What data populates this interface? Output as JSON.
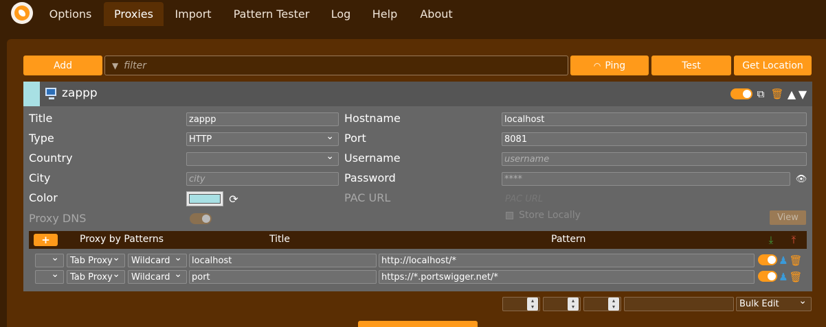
{
  "nav": {
    "tabs": [
      "Options",
      "Proxies",
      "Import",
      "Pattern Tester",
      "Log",
      "Help",
      "About"
    ],
    "active": "Proxies"
  },
  "toolbar": {
    "add": "Add",
    "filter_placeholder": "filter",
    "ping": "Ping",
    "test": "Test",
    "get_location": "Get Location"
  },
  "proxy": {
    "name": "zappp",
    "color": "#a8e0e4",
    "labels": {
      "title": "Title",
      "type": "Type",
      "country": "Country",
      "city": "City",
      "color": "Color",
      "proxy_dns": "Proxy DNS",
      "hostname": "Hostname",
      "port": "Port",
      "username": "Username",
      "password": "Password",
      "pac_url": "PAC URL"
    },
    "title_value": "zappp",
    "type_value": "HTTP",
    "country_value": "",
    "city_placeholder": "city",
    "hostname_value": "localhost",
    "port_value": "8081",
    "username_placeholder": "username",
    "password_placeholder": "****",
    "pac_url_placeholder": "PAC URL",
    "store_locally": "Store Locally",
    "view": "View"
  },
  "patterns": {
    "add_label": "+",
    "headers": [
      "Proxy by Patterns",
      "Title",
      "Pattern"
    ],
    "rows": [
      {
        "scope": "Tab Proxy",
        "kind": "Wildcard",
        "title": "localhost",
        "pattern": "http://localhost/*"
      },
      {
        "scope": "Tab Proxy",
        "kind": "Wildcard",
        "title": "port",
        "pattern": "https://*.portswigger.net/*"
      }
    ]
  },
  "bottom": {
    "bulk_edit": "Bulk Edit"
  },
  "colors": {
    "accent": "#ff9a1a",
    "background": "#3b1f04",
    "panel": "#666666"
  }
}
